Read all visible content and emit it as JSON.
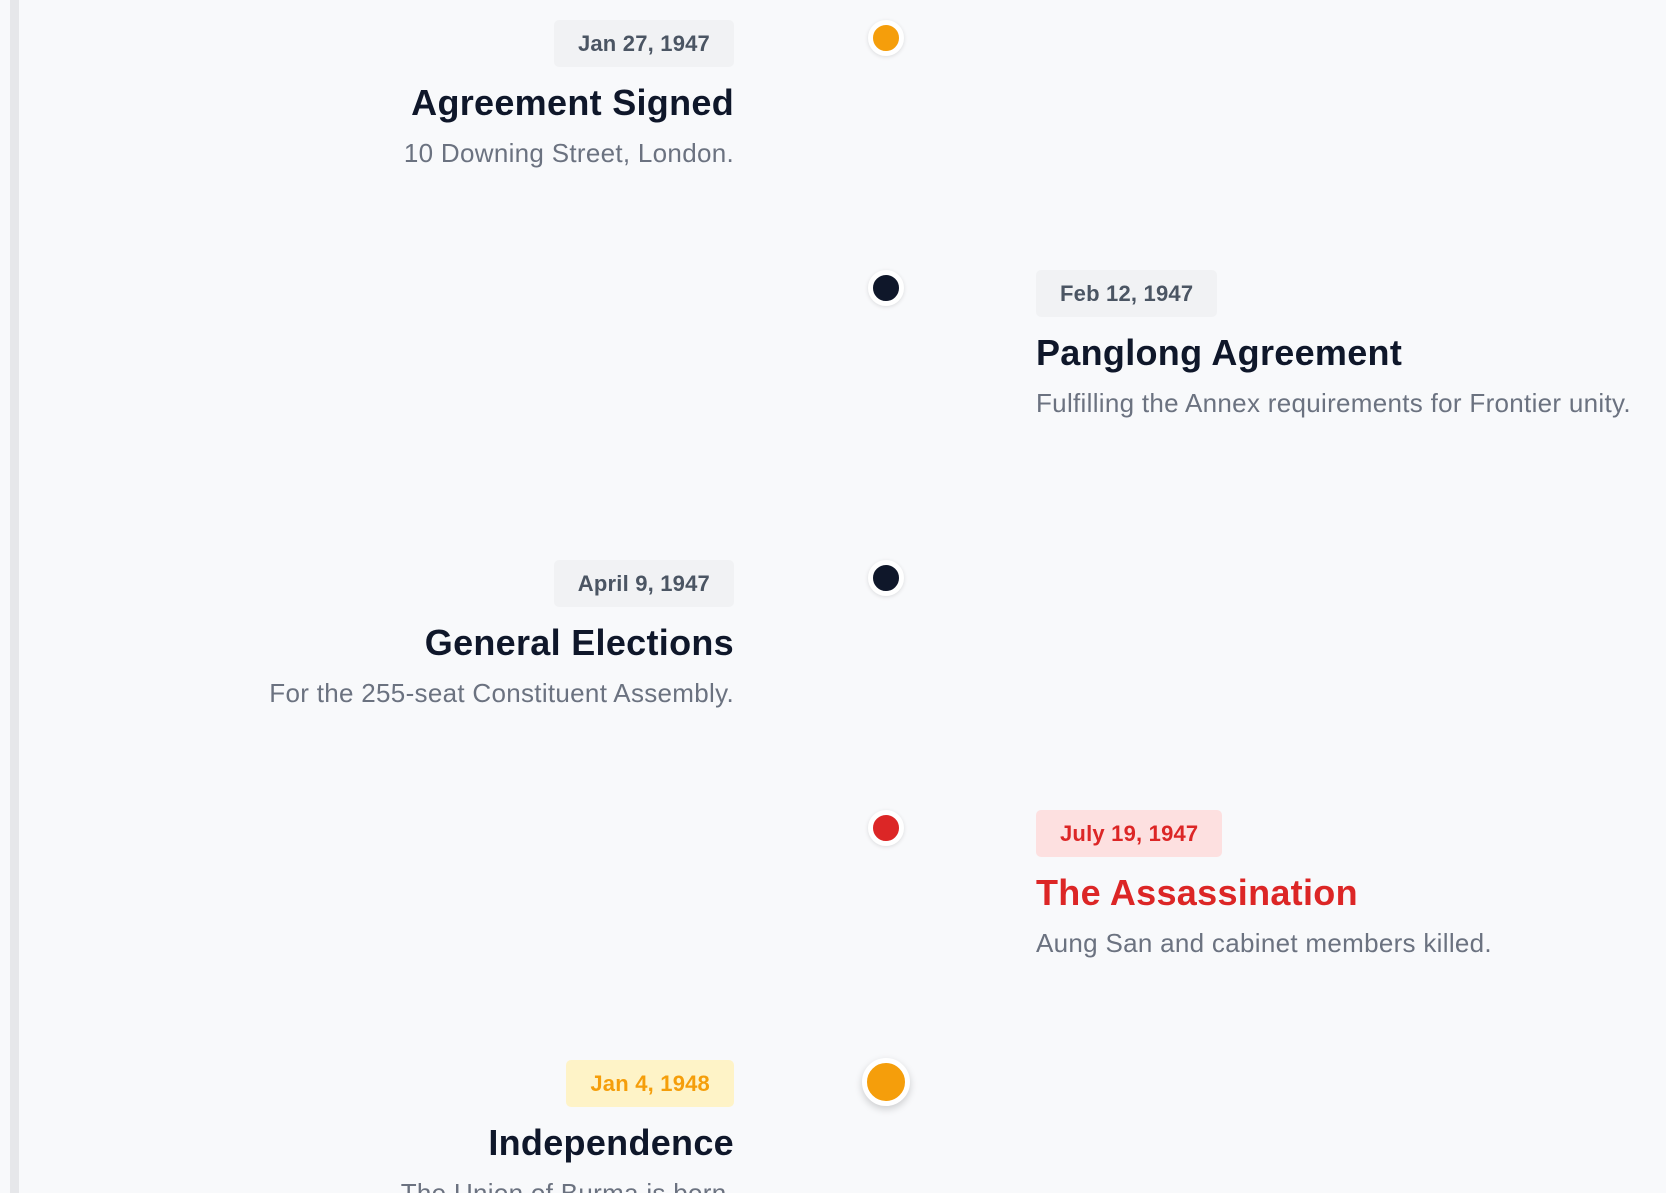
{
  "timeline": {
    "events": [
      {
        "date": "Jan 27, 1947",
        "title": "Agreement Signed",
        "description": "10 Downing Street, London.",
        "dot_color": "#f59e0b"
      },
      {
        "date": "Feb 12, 1947",
        "title": "Panglong Agreement",
        "description": "Fulfilling the Annex requirements for Frontier unity.",
        "dot_color": "#0f172a"
      },
      {
        "date": "April 9, 1947",
        "title": "General Elections",
        "description": "For the 255-seat Constituent Assembly.",
        "dot_color": "#0f172a"
      },
      {
        "date": "July 19, 1947",
        "title": "The Assassination",
        "description": "Aung San and cabinet members killed.",
        "dot_color": "#dc2626"
      },
      {
        "date": "Jan 4, 1948",
        "title": "Independence",
        "description": "The Union of Burma is born.",
        "dot_color": "#f59e0b"
      }
    ]
  }
}
